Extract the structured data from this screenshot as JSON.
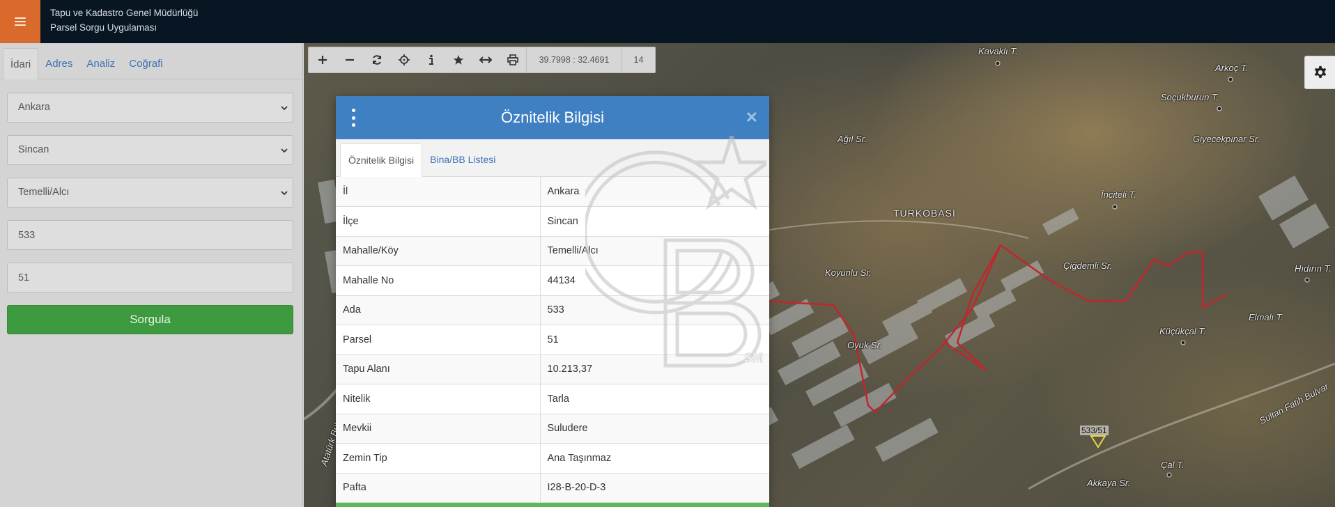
{
  "header": {
    "org_name": "Tapu ve Kadastro Genel Müdürlüğü",
    "app_name": "Parsel Sorgu Uygulaması"
  },
  "sidebar": {
    "tabs": [
      {
        "label": "İdari",
        "active": true
      },
      {
        "label": "Adres",
        "active": false
      },
      {
        "label": "Analiz",
        "active": false
      },
      {
        "label": "Coğrafi",
        "active": false
      }
    ],
    "il_select": "Ankara",
    "ilce_select": "Sincan",
    "mahalle_select": "Temelli/Alcı",
    "ada_input": "533",
    "parsel_input": "51",
    "submit_label": "Sorgula"
  },
  "toolbar": {
    "coordinates": "39.7998 : 32.4691",
    "zoom_level": "14"
  },
  "map": {
    "labels": [
      "Kavaklı T.",
      "Arkoç T.",
      "Soçukburun T.",
      "Giyecekpınar Sr.",
      "Ağıl Sr.",
      "TURKOBASI",
      "İnciteli T.",
      "Çiğdemli Sr.",
      "Koyunlu Sr.",
      "Hıdırın T.",
      "Elmalı T.",
      "Küçükçal T.",
      "Sultan Fatih Bulvar",
      "Çal T.",
      "Akkaya Sr.",
      "Oyuk Sr.",
      "Atatürk Bulvar"
    ],
    "parcel_label": "533/51"
  },
  "modal": {
    "title": "Öznitelik Bilgisi",
    "tabs": [
      {
        "label": "Öznitelik Bilgisi",
        "active": true
      },
      {
        "label": "Bina/BB Listesi",
        "active": false
      }
    ],
    "rows": [
      {
        "key": "İl",
        "value": "Ankara"
      },
      {
        "key": "İlçe",
        "value": "Sincan"
      },
      {
        "key": "Mahalle/Köy",
        "value": "Temelli/Alcı"
      },
      {
        "key": "Mahalle No",
        "value": "44134"
      },
      {
        "key": "Ada",
        "value": "533"
      },
      {
        "key": "Parsel",
        "value": "51"
      },
      {
        "key": "Tapu Alanı",
        "value": "10.213,37"
      },
      {
        "key": "Nitelik",
        "value": "Tarla"
      },
      {
        "key": "Mevkii",
        "value": "Suludere"
      },
      {
        "key": "Zemin Tip",
        "value": "Ana Taşınmaz"
      },
      {
        "key": "Pafta",
        "value": "I28-B-20-D-3"
      }
    ]
  },
  "watermark": {
    "mark": "SM"
  },
  "colors": {
    "header_bg": "#081624",
    "menu_accent": "#d96a2b",
    "modal_header": "#3f80c2",
    "submit_green": "#3e9a3e",
    "boundary_red": "#c0262d"
  }
}
